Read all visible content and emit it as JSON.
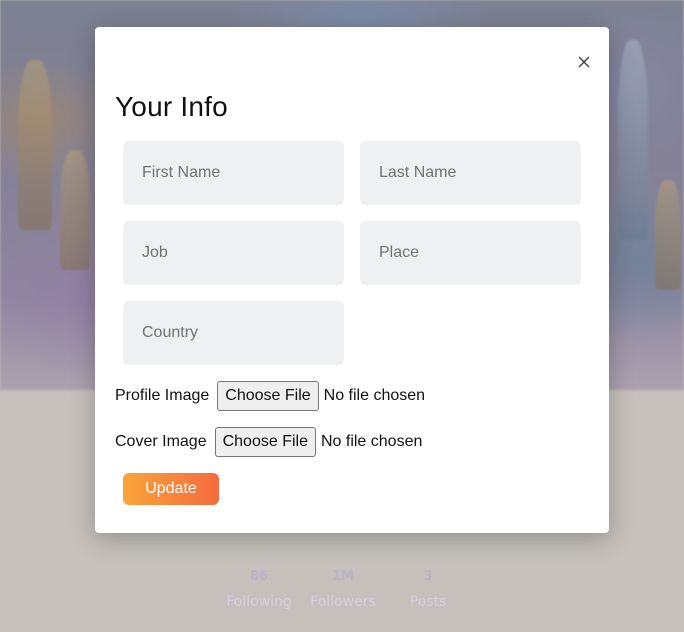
{
  "modal": {
    "title": "Your Info",
    "fields": {
      "first_name_placeholder": "First Name",
      "last_name_placeholder": "Last Name",
      "job_placeholder": "Job",
      "place_placeholder": "Place",
      "country_placeholder": "Country"
    },
    "profile_image": {
      "label": "Profile Image",
      "button": "Choose File",
      "status": "No file chosen"
    },
    "cover_image": {
      "label": "Cover Image",
      "button": "Choose File",
      "status": "No file chosen"
    },
    "update_label": "Update",
    "close_icon": "close-icon"
  },
  "background": {
    "stats": [
      {
        "value": "86",
        "label": "Following"
      },
      {
        "value": "1M",
        "label": "Followers"
      },
      {
        "value": "3",
        "label": "Posts"
      }
    ]
  },
  "colors": {
    "accent_start": "#f9a53a",
    "accent_end": "#f56a3e",
    "field_bg": "#eff0f1"
  }
}
